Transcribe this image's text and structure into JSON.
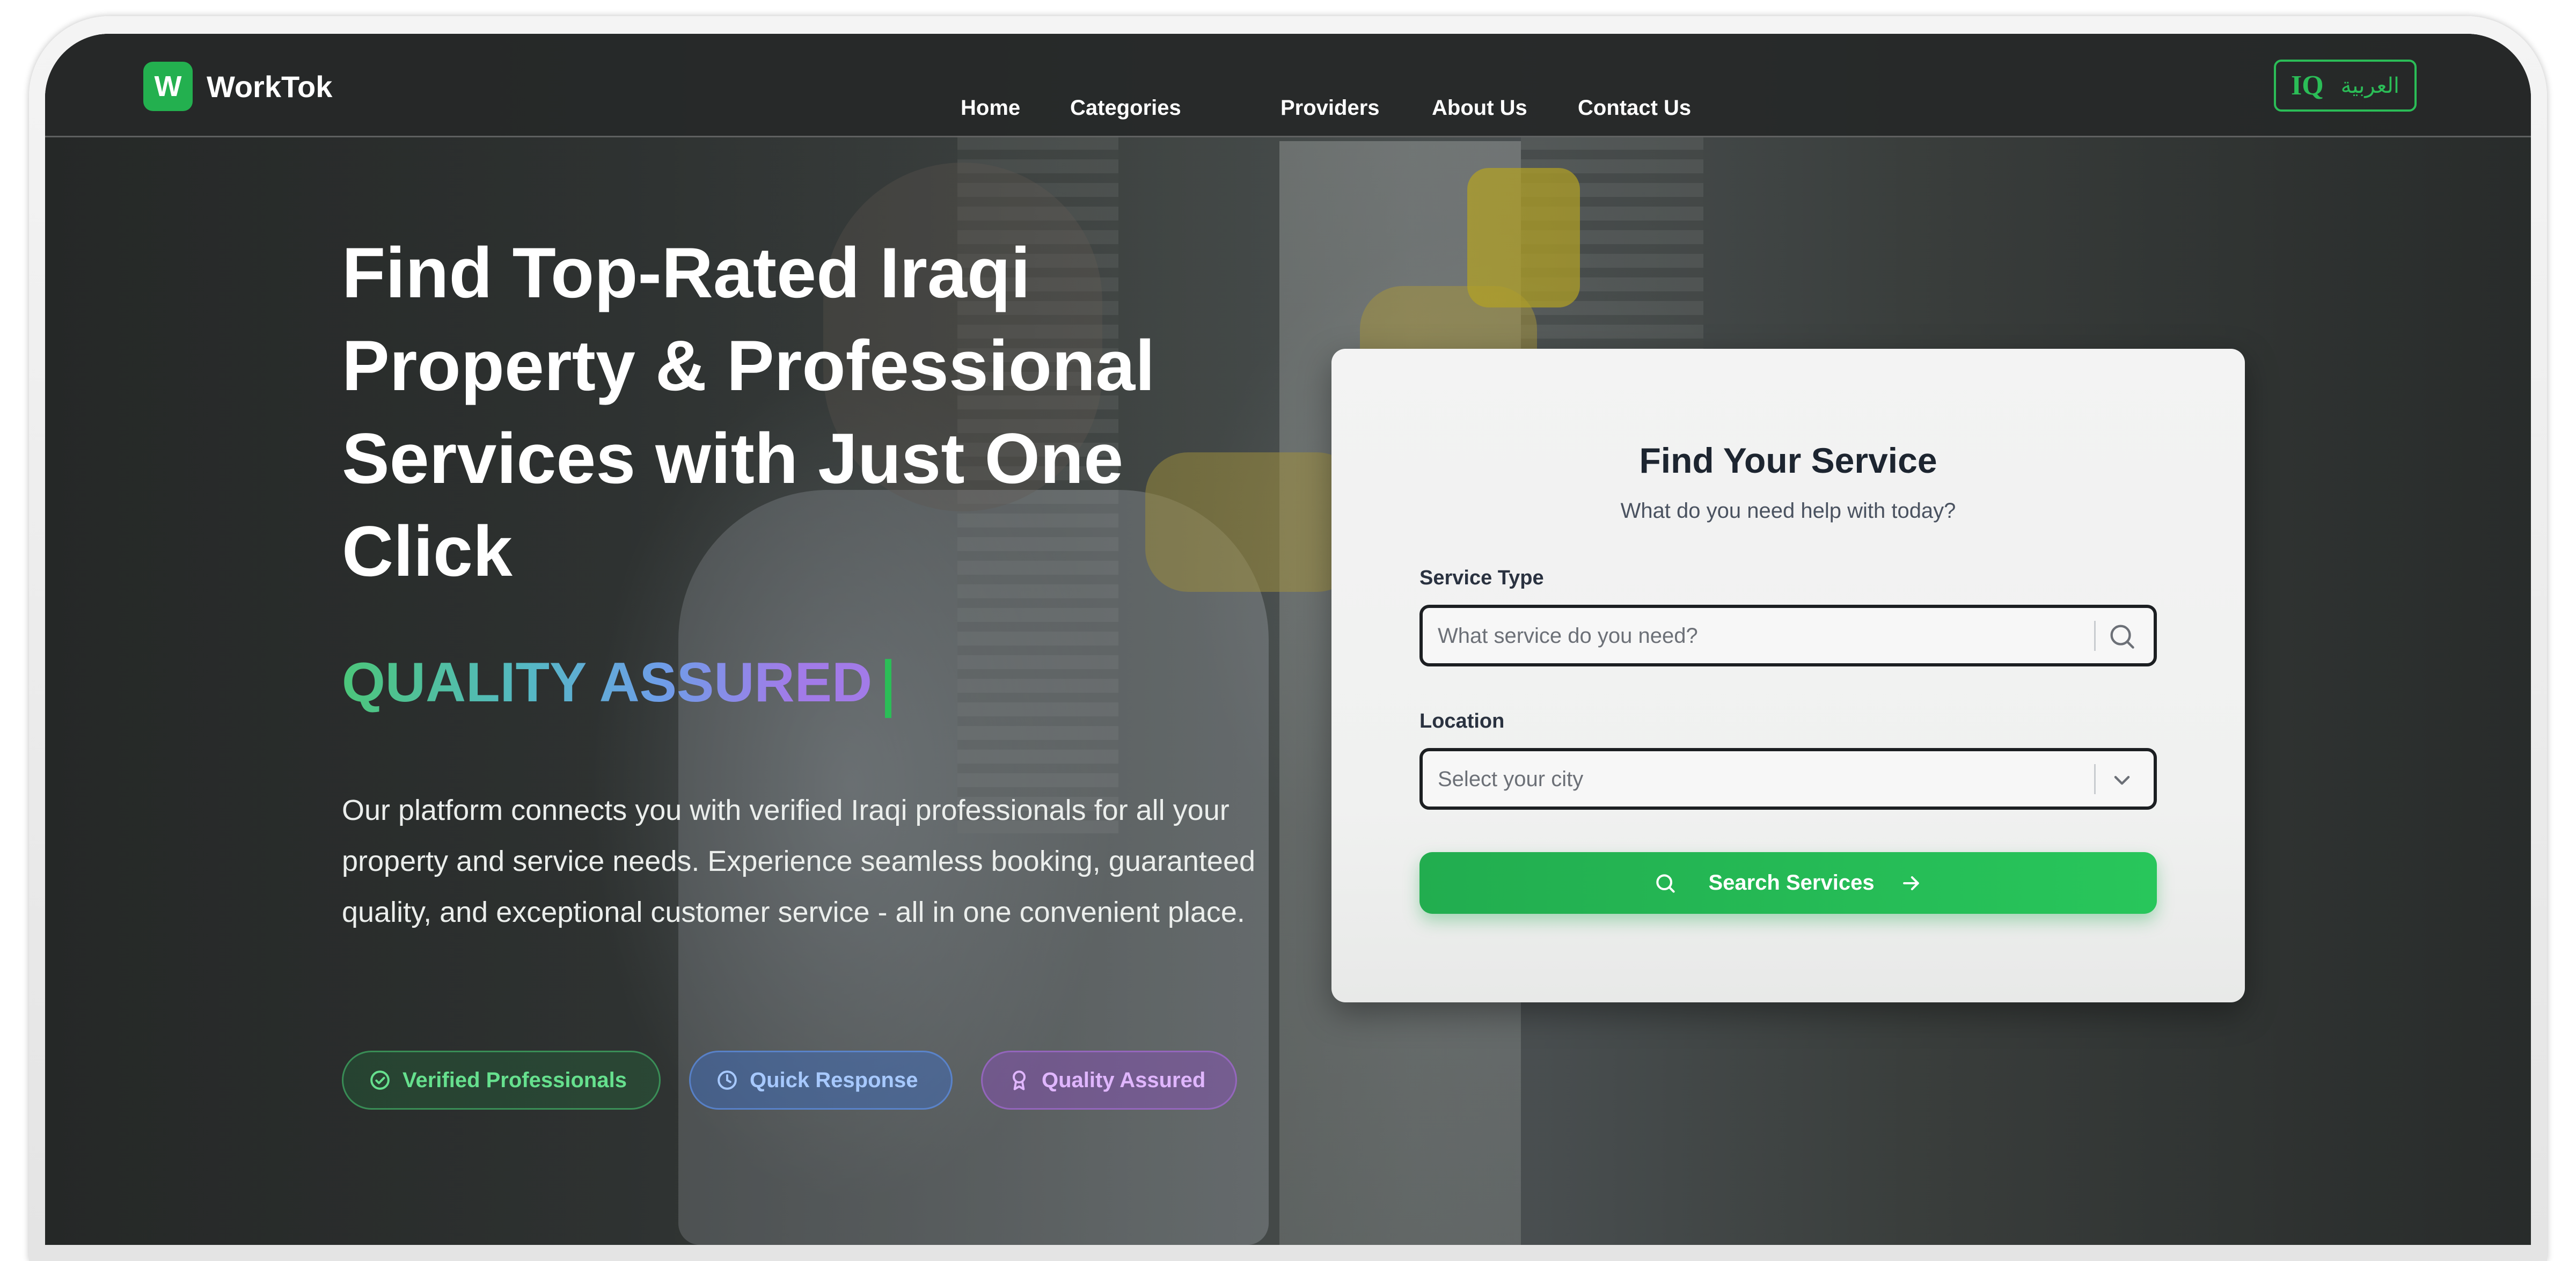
{
  "nav": {
    "brand_logo_letter": "W",
    "brand_name": "WorkTok",
    "links": [
      "Home",
      "Categories",
      "Providers",
      "About Us",
      "Contact Us"
    ],
    "language": {
      "code": "IQ",
      "label": "العربية"
    }
  },
  "hero": {
    "title": "Find Top-Rated Iraqi Property & Professional Services with Just One Click",
    "tagline": "QUALITY ASSURED",
    "description": "Our platform connects you with verified Iraqi professionals for all your property and service needs. Experience seamless booking, guaranteed quality, and exceptional customer service - all in one convenient place.",
    "badges": [
      {
        "label": "Verified Professionals",
        "icon": "check-circle-icon",
        "color": "#66e08e"
      },
      {
        "label": "Quick Response",
        "icon": "clock-icon",
        "color": "#a7c9ff"
      },
      {
        "label": "Quality Assured",
        "icon": "award-icon",
        "color": "#e0b6ff"
      }
    ]
  },
  "search_card": {
    "title": "Find Your Service",
    "subtitle": "What do you need help with today?",
    "service_type": {
      "label": "Service Type",
      "placeholder": "What service do you need?",
      "icon": "search-icon"
    },
    "location": {
      "label": "Location",
      "placeholder": "Select your city",
      "icon": "chevron-down-icon"
    },
    "submit_label": "Search Services"
  },
  "colors": {
    "accent": "#23b04f",
    "nav_bg": "#262828",
    "card_bg": "#f3f3f3",
    "text_dark": "#1d2530"
  }
}
